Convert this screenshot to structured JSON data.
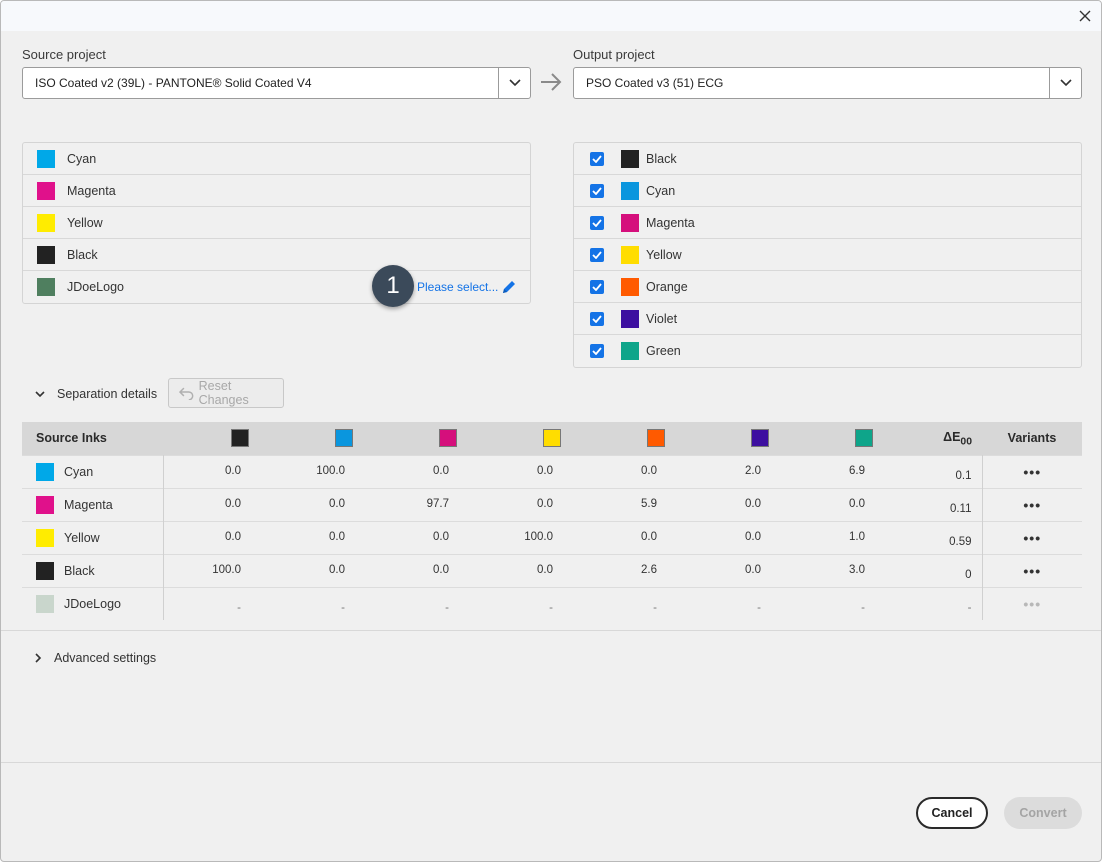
{
  "dialog": {
    "close_icon": "close-icon"
  },
  "source": {
    "label": "Source project",
    "value": "ISO Coated v2 (39L) - PANTONE® Solid Coated V4",
    "inks": [
      {
        "name": "Cyan",
        "color": "#00a8e8"
      },
      {
        "name": "Magenta",
        "color": "#e0118b"
      },
      {
        "name": "Yellow",
        "color": "#ffec00"
      },
      {
        "name": "Black",
        "color": "#222222"
      },
      {
        "name": "JDoeLogo",
        "color": "#4f7f5f"
      }
    ],
    "please_select": "Please select...",
    "badge": "1"
  },
  "output": {
    "label": "Output project",
    "value": "PSO Coated v3 (51) ECG",
    "inks": [
      {
        "name": "Black",
        "color": "#222222",
        "checked": true
      },
      {
        "name": "Cyan",
        "color": "#0a96de",
        "checked": true
      },
      {
        "name": "Magenta",
        "color": "#d50f7c",
        "checked": true
      },
      {
        "name": "Yellow",
        "color": "#ffdd00",
        "checked": true
      },
      {
        "name": "Orange",
        "color": "#ff5a00",
        "checked": true
      },
      {
        "name": "Violet",
        "color": "#3d0fa0",
        "checked": true
      },
      {
        "name": "Green",
        "color": "#0ea58a",
        "checked": true
      }
    ]
  },
  "separation": {
    "toggle_label": "Separation details",
    "reset_label": "Reset Changes",
    "header_source": "Source Inks",
    "header_delta": "ΔE",
    "header_delta_sub": "00",
    "header_variants": "Variants",
    "column_colors": [
      "#222222",
      "#0a96de",
      "#d50f7c",
      "#ffdd00",
      "#ff5a00",
      "#3d0fa0",
      "#0ea58a"
    ],
    "rows": [
      {
        "name": "Cyan",
        "color": "#00a8e8",
        "values": [
          "0.0",
          "100.0",
          "0.0",
          "0.0",
          "0.0",
          "2.0",
          "6.9"
        ],
        "delta": "0.1",
        "variants": "•••"
      },
      {
        "name": "Magenta",
        "color": "#e0118b",
        "values": [
          "0.0",
          "0.0",
          "97.7",
          "0.0",
          "5.9",
          "0.0",
          "0.0"
        ],
        "delta": "0.11",
        "variants": "•••"
      },
      {
        "name": "Yellow",
        "color": "#ffec00",
        "values": [
          "0.0",
          "0.0",
          "0.0",
          "100.0",
          "0.0",
          "0.0",
          "1.0"
        ],
        "delta": "0.59",
        "variants": "•••"
      },
      {
        "name": "Black",
        "color": "#222222",
        "values": [
          "100.0",
          "0.0",
          "0.0",
          "0.0",
          "2.6",
          "0.0",
          "3.0"
        ],
        "delta": "0",
        "variants": "•••"
      },
      {
        "name": "JDoeLogo",
        "color": "#c9d6cc",
        "values": [
          "-",
          "-",
          "-",
          "-",
          "-",
          "-",
          "-"
        ],
        "delta": "-",
        "variants": "•••",
        "disabled": true
      }
    ]
  },
  "advanced": {
    "label": "Advanced settings"
  },
  "footer": {
    "cancel": "Cancel",
    "convert": "Convert"
  }
}
